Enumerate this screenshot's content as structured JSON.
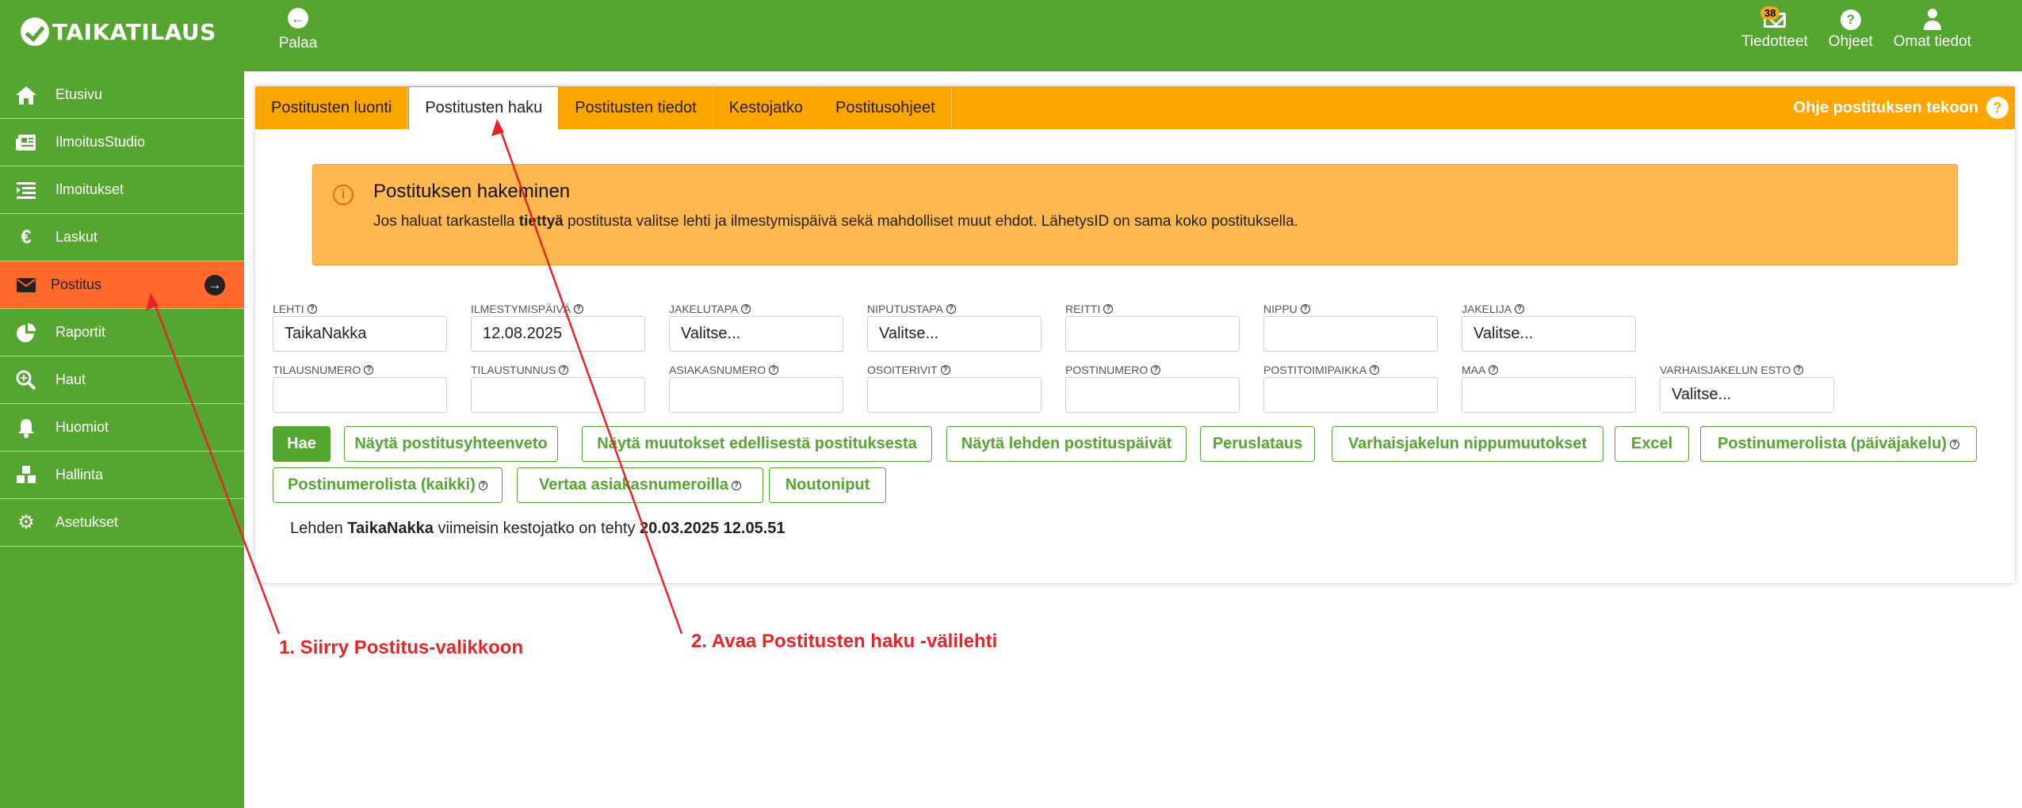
{
  "app": {
    "logo_text": "TAIKATILAUS"
  },
  "topbar": {
    "back_label": "Palaa",
    "notifications_label": "Tiedotteet",
    "notifications_count": "38",
    "help_label": "Ohjeet",
    "profile_label": "Omat tiedot"
  },
  "sidebar": {
    "items": [
      {
        "label": "Etusivu",
        "icon": "home-icon"
      },
      {
        "label": "IlmoitusStudio",
        "icon": "newspaper-icon"
      },
      {
        "label": "Ilmoitukset",
        "icon": "list-icon"
      },
      {
        "label": "Laskut",
        "icon": "euro-icon"
      },
      {
        "label": "Postitus",
        "icon": "envelope-icon"
      },
      {
        "label": "Raportit",
        "icon": "pie-chart-icon"
      },
      {
        "label": "Haut",
        "icon": "search-icon"
      },
      {
        "label": "Huomiot",
        "icon": "bell-icon"
      },
      {
        "label": "Hallinta",
        "icon": "cubes-icon"
      },
      {
        "label": "Asetukset",
        "icon": "gear-icon"
      }
    ]
  },
  "tabs": [
    {
      "label": "Postitusten luonti"
    },
    {
      "label": "Postitusten haku"
    },
    {
      "label": "Postitusten tiedot"
    },
    {
      "label": "Kestojatko"
    },
    {
      "label": "Postitusohjeet"
    }
  ],
  "tab_help": "Ohje postituksen tekoon",
  "info": {
    "title": "Postituksen hakeminen",
    "text_before": "Jos haluat tarkastella ",
    "text_bold": "tiettyä",
    "text_after": " postitusta valitse lehti ja ilmestymispäivä sekä mahdolliset muut ehdot. LähetysID on sama koko postituksella."
  },
  "fields_row1": [
    {
      "label": "LEHTI",
      "value": "TaikaNakka"
    },
    {
      "label": "ILMESTYMISPÄIVÄ",
      "value": "12.08.2025"
    },
    {
      "label": "JAKELUTAPA",
      "value": "Valitse..."
    },
    {
      "label": "NIPUTUSTAPA",
      "value": "Valitse..."
    },
    {
      "label": "REITTI",
      "value": ""
    },
    {
      "label": "NIPPU",
      "value": ""
    },
    {
      "label": "JAKELIJA",
      "value": "Valitse..."
    }
  ],
  "fields_row2": [
    {
      "label": "TILAUSNUMERO",
      "value": ""
    },
    {
      "label": "TILAUSTUNNUS",
      "value": ""
    },
    {
      "label": "ASIAKASNUMERO",
      "value": ""
    },
    {
      "label": "OSOITERIVIT",
      "value": ""
    },
    {
      "label": "POSTINUMERO",
      "value": ""
    },
    {
      "label": "POSTITOIMIPAIKKA",
      "value": ""
    },
    {
      "label": "MAA",
      "value": ""
    },
    {
      "label": "VARHAISJAKELUN ESTO",
      "value": "Valitse..."
    }
  ],
  "buttons": {
    "search": "Hae",
    "summary": "Näytä postitusyhteenveto",
    "changes": "Näytä muutokset edellisestä postituksesta",
    "dates": "Näytä lehden postituspäivät",
    "base": "Peruslataus",
    "early": "Varhaisjakelun nippumuutokset",
    "excel": "Excel",
    "postal_daily": "Postinumerolista (päiväjakelu)",
    "postal_all": "Postinumerolista (kaikki)",
    "compare": "Vertaa asiakasnumeroilla",
    "pickup": "Noutoniput"
  },
  "last_renewal": {
    "prefix": "Lehden ",
    "paper": "TaikaNakka",
    "middle": " viimeisin kestojatko on tehty ",
    "datetime": "20.03.2025 12.05.51"
  },
  "annotations": {
    "step1": "1. Siirry Postitus-valikkoon",
    "step2": "2. Avaa Postitusten haku -välilehti"
  }
}
